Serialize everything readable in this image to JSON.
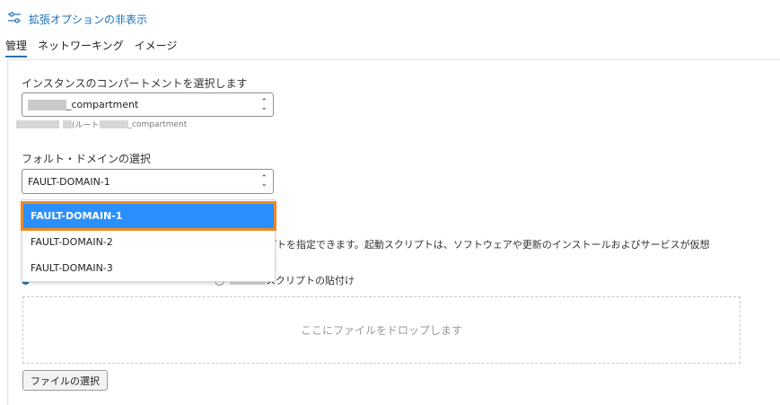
{
  "toggle": {
    "label": "拡張オプションの非表示",
    "icon": "sliders-icon"
  },
  "tabs": [
    {
      "label": "管理",
      "active": true
    },
    {
      "label": "ネットワーキング",
      "active": false
    },
    {
      "label": "イメージ",
      "active": false
    }
  ],
  "compartment": {
    "label": "インスタンスのコンパートメントを選択します",
    "selected_suffix": "_compartment",
    "hint_middle": " (ルート",
    "hint_suffix": "_compartment"
  },
  "fault_domain": {
    "label": "フォルト・ドメインの選択",
    "selected": "FAULT-DOMAIN-1",
    "options": [
      "FAULT-DOMAIN-1",
      "FAULT-DOMAIN-2",
      "FAULT-DOMAIN-3"
    ]
  },
  "init_script": {
    "description": "リプトを指定できます。起動スクリプトは、ソフトウェアや更新のインストールおよびサービスが仮想",
    "radio_paste_suffix": "スクリプトの貼付け",
    "dropzone_text": "ここにファイルをドロップします",
    "select_file_button": "ファイルの選択"
  },
  "colors": {
    "accent": "#2c6fb7",
    "selected_option": "#2b90ff",
    "highlight_border": "#f08a24"
  }
}
